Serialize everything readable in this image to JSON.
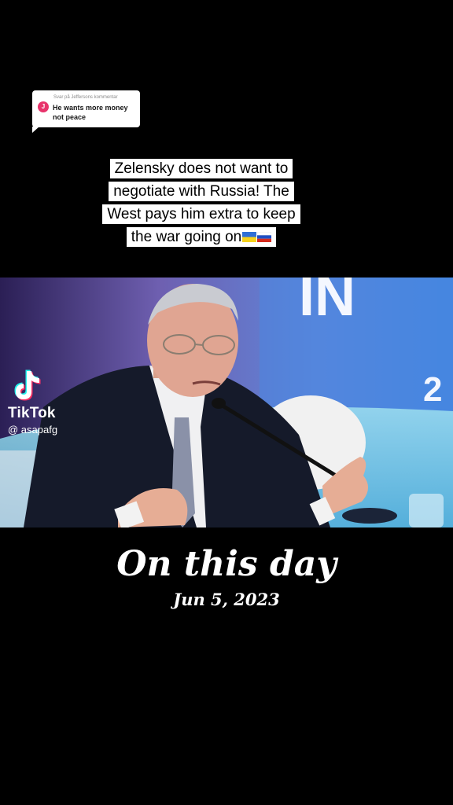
{
  "reply": {
    "meta": "Svar på Jeffersons kommentar",
    "avatar_initial": "J",
    "text": "He wants more money not peace"
  },
  "caption": {
    "lines": [
      "Zelensky does not want to",
      "negotiate with Russia!  The",
      "West pays him extra to keep",
      "the war going on"
    ],
    "flags": [
      "ukraine-flag",
      "russia-flag"
    ]
  },
  "video": {
    "backdrop_text": "IN",
    "backdrop_number": "2"
  },
  "watermark": {
    "brand": "TikTok",
    "username": "@ asapafg"
  },
  "on_this_day": {
    "title": "On this day",
    "date": "Jun 5, 2023"
  }
}
